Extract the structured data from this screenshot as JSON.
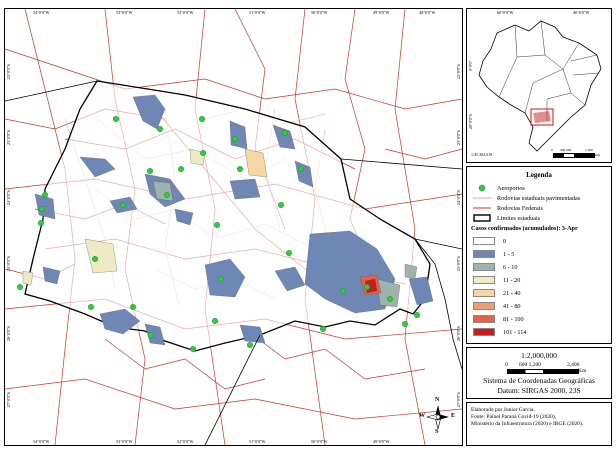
{
  "map": {
    "lon_labels": [
      "54°0'0\"W",
      "53°0'0\"W",
      "52°0'0\"W",
      "51°0'0\"W",
      "50°0'0\"W",
      "49°0'0\"W",
      "48°0'0\"W"
    ],
    "lat_labels": [
      "22°0'0\"S",
      "23°0'0\"S",
      "24°0'0\"S",
      "25°0'0\"S",
      "26°0'0\"S",
      "27°0'0\"S"
    ]
  },
  "inset": {
    "lon_labels": [
      "60°0'0\"W",
      "40°0'0\"W"
    ],
    "lat_labels": [
      "0°0'0\"",
      "20°0'0\"S"
    ],
    "scale_text": "1:45.304,618",
    "scale_ticks": [
      "0",
      "300 600",
      "1.200",
      "Km"
    ]
  },
  "legend": {
    "title": "Legenda",
    "items": [
      {
        "label": "Aeroportos",
        "symbol": "airport-dot-icon"
      },
      {
        "label": "Rodovias estaduais pavimentadas",
        "symbol": "state-road-line"
      },
      {
        "label": "Rodovias Federais",
        "symbol": "federal-road-line"
      },
      {
        "label": "Limites estaduais",
        "symbol": "state-boundary-box"
      }
    ],
    "cases_title": "Casos confirmados (acumulados): 3-Apr",
    "classes": [
      {
        "label": "0",
        "color": "#ffffff"
      },
      {
        "label": "1 - 5",
        "color": "#6f87b4"
      },
      {
        "label": "6 - 10",
        "color": "#9fb3ae"
      },
      {
        "label": "11 - 20",
        "color": "#eeeac4"
      },
      {
        "label": "21 - 40",
        "color": "#f6d7a1"
      },
      {
        "label": "41 - 80",
        "color": "#ee9f72"
      },
      {
        "label": "81 - 100",
        "color": "#e26346"
      },
      {
        "label": "101 - 114",
        "color": "#c51c1c"
      }
    ]
  },
  "scale": {
    "ratio": "1:2,000,000",
    "ticks": [
      "0",
      "600 1,200",
      "2,400"
    ],
    "unit": "Km",
    "crs_line1": "Sistema de Coordenadas Geográficas",
    "crs_line2": "Datum: SIRGAS 2000, 23S"
  },
  "north_arrow": {
    "n": "N",
    "s": "S",
    "e": "E",
    "w": "W"
  },
  "credits": {
    "line1": "Elaborado por Junior Garcia.",
    "line2": "Fonte: Painel Paraná Covid-19 (2020),",
    "line3": "Ministério da Infraestrutura (2020) e IBGE (2020)."
  },
  "colors": {
    "federal_road": "#c0392b",
    "state_road": "#e8a0a0",
    "airport": "#2ecc40",
    "border": "#000000"
  }
}
